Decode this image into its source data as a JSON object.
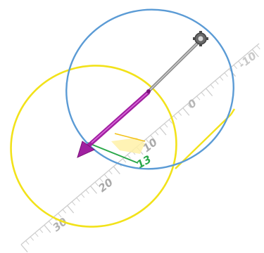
{
  "ruler": {
    "tick_labels": [
      "-10",
      "0",
      "10",
      "20",
      "30"
    ]
  },
  "measurement": {
    "value": "13"
  },
  "colors": {
    "yellow_ring": "#f2e21a",
    "blue_ring": "#5b9bd5",
    "vector": "#a020a0",
    "rod": "#9a9a9a",
    "measure": "#2aa84a",
    "highlight": "#fff1a8",
    "ruler": "#c8c8c8",
    "ruler_text": "#b0b0b0"
  },
  "icons": {
    "top_handle": "move-handle-icon",
    "arrow_head": "arrow-head-icon"
  }
}
